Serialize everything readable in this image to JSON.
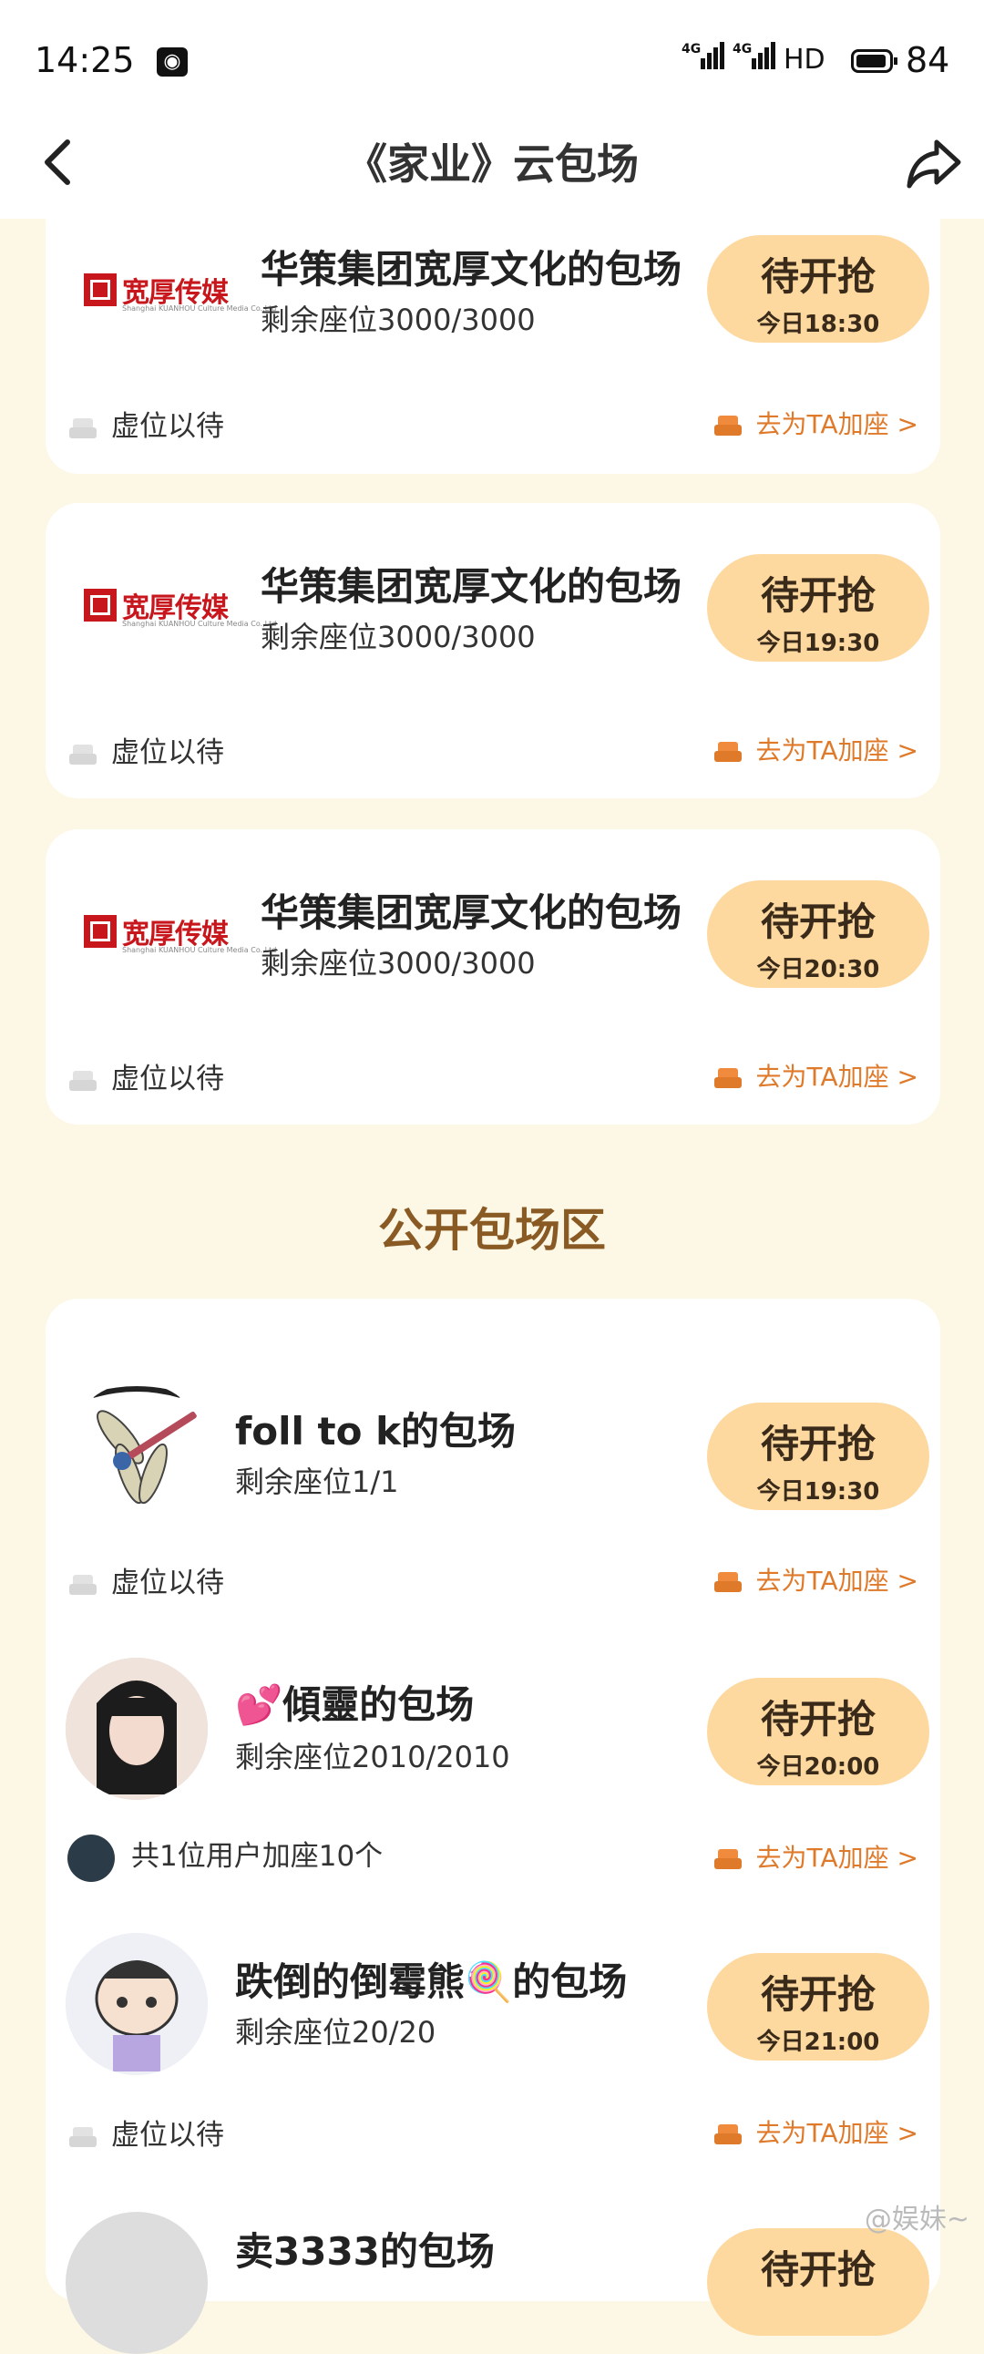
{
  "status_bar": {
    "time": "14:25",
    "network": [
      "4G",
      "4G"
    ],
    "hd": "HD",
    "battery": "84"
  },
  "nav": {
    "title": "《家业》云包场"
  },
  "top_cards": [
    {
      "logo_text": "宽厚传媒",
      "logo_sub": "Shanghai KUANHOU Culture Media Co.,Ltd",
      "title": "华策集团宽厚文化的包场",
      "seats": "剩余座位3000/3000",
      "button": "待开抢",
      "time": "今日18:30",
      "footer_left": "虚位以待",
      "footer_right": "去为TA加座 >"
    },
    {
      "logo_text": "宽厚传媒",
      "logo_sub": "Shanghai KUANHOU Culture Media Co.,Ltd",
      "title": "华策集团宽厚文化的包场",
      "seats": "剩余座位3000/3000",
      "button": "待开抢",
      "time": "今日19:30",
      "footer_left": "虚位以待",
      "footer_right": "去为TA加座 >"
    },
    {
      "logo_text": "宽厚传媒",
      "logo_sub": "Shanghai KUANHOU Culture Media Co.,Ltd",
      "title": "华策集团宽厚文化的包场",
      "seats": "剩余座位3000/3000",
      "button": "待开抢",
      "time": "今日20:30",
      "footer_left": "虚位以待",
      "footer_right": "去为TA加座 >"
    }
  ],
  "public_section": {
    "title": "公开包场区",
    "items": [
      {
        "title": "foll to k的包场",
        "seats": "剩余座位1/1",
        "button": "待开抢",
        "time": "今日19:30",
        "footer_left": "虚位以待",
        "footer_right": "去为TA加座 >"
      },
      {
        "title": "💕傾靈的包场",
        "seats": "剩余座位2010/2010",
        "button": "待开抢",
        "time": "今日20:00",
        "footer_left": "共1位用户加座10个",
        "footer_right": "去为TA加座 >"
      },
      {
        "title": "跌倒的倒霉熊🍭的包场",
        "seats": "剩余座位20/20",
        "button": "待开抢",
        "time": "今日21:00",
        "footer_left": "虚位以待",
        "footer_right": "去为TA加座 >"
      },
      {
        "title": "卖3333的包场",
        "button": "待开抢"
      }
    ]
  },
  "watermark": "@娱妹~"
}
